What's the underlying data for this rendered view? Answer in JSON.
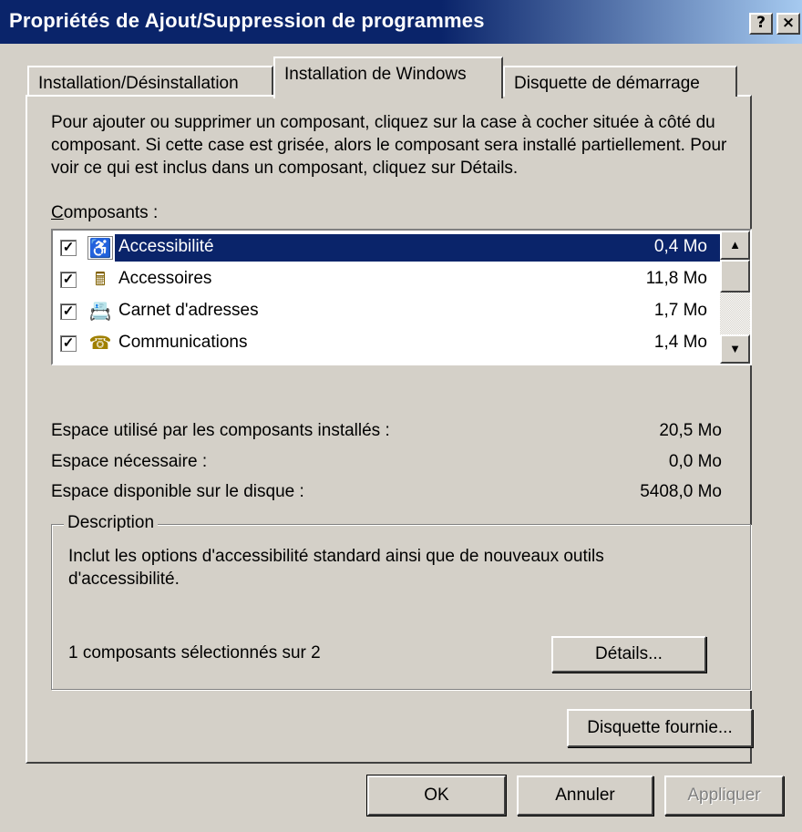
{
  "window": {
    "title": "Propriétés de Ajout/Suppression de programmes",
    "help_glyph": "?",
    "close_glyph": "×"
  },
  "tabs": [
    {
      "label": "Installation/Désinstallation",
      "selected": false
    },
    {
      "label": "Installation de Windows",
      "selected": true
    },
    {
      "label": "Disquette de démarrage",
      "selected": false
    }
  ],
  "intro_text": "Pour ajouter ou supprimer un composant, cliquez sur la case à cocher située à côté du composant. Si cette case est grisée, alors le composant sera installé partiellement. Pour voir ce qui est inclus dans un composant, cliquez sur Détails.",
  "components_label_first": "C",
  "components_label_rest": "omposants :",
  "components": [
    {
      "name": "Accessibilité",
      "size": "0,4 Mo",
      "checked": true,
      "selected": true,
      "icon": "accessibility-icon",
      "icon_glyph": "♿"
    },
    {
      "name": "Accessoires",
      "size": "11,8 Mo",
      "checked": true,
      "selected": false,
      "icon": "accessories-icon",
      "icon_glyph": "🖩"
    },
    {
      "name": "Carnet d'adresses",
      "size": "1,7 Mo",
      "checked": true,
      "selected": false,
      "icon": "address-book-icon",
      "icon_glyph": "📇"
    },
    {
      "name": "Communications",
      "size": "1,4 Mo",
      "checked": true,
      "selected": false,
      "icon": "communications-icon",
      "icon_glyph": "☎"
    }
  ],
  "check_glyph": "✓",
  "scroll": {
    "up_glyph": "▲",
    "down_glyph": "▼"
  },
  "space": {
    "used_label": "Espace utilisé par les composants installés :",
    "used_value": "20,5 Mo",
    "needed_label": "Espace nécessaire :",
    "needed_value": "0,0 Mo",
    "available_label": "Espace disponible sur le disque :",
    "available_value": "5408,0 Mo"
  },
  "description": {
    "group_title": "Description",
    "text": "Inclut les options d'accessibilité standard ainsi que de nouveaux outils d'accessibilité.",
    "selection_count": "1 composants sélectionnés sur 2"
  },
  "buttons": {
    "details": "Détails...",
    "disk_provided": "Disquette fournie...",
    "ok": "OK",
    "cancel": "Annuler",
    "apply": "Appliquer"
  },
  "colors": {
    "selection": "#0a246a",
    "face": "#d4d0c8"
  }
}
